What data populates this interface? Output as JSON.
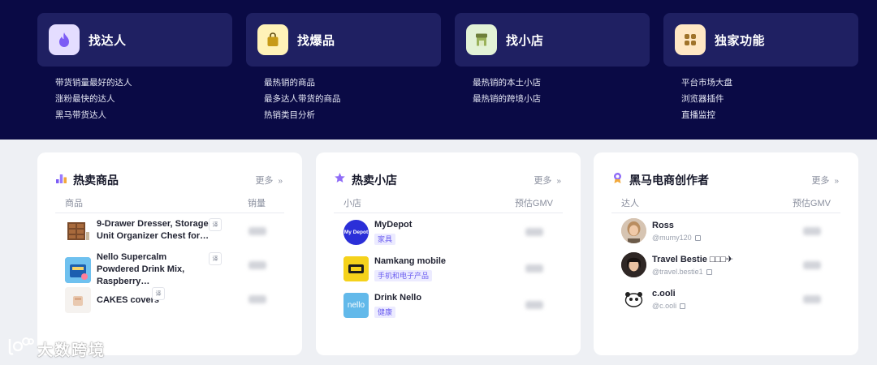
{
  "nav": [
    {
      "title": "找达人",
      "icon": "flame-icon",
      "icon_bg": "#e4ddff",
      "links": [
        "带货销量最好的达人",
        "涨粉最快的达人",
        "黑马带货达人"
      ]
    },
    {
      "title": "找爆品",
      "icon": "shopping-bag-icon",
      "icon_bg": "#fff2b8",
      "links": [
        "最热销的商品",
        "最多达人带货的商品",
        "热销类目分析"
      ]
    },
    {
      "title": "找小店",
      "icon": "storefront-icon",
      "icon_bg": "#e3f2d6",
      "links": [
        "最热销的本土小店",
        "最热销的跨境小店"
      ]
    },
    {
      "title": "独家功能",
      "icon": "grid-icon",
      "icon_bg": "#ffe7c4",
      "links": [
        "平台市场大盘",
        "浏览器插件",
        "直播监控"
      ]
    }
  ],
  "panels": {
    "products": {
      "title": "热卖商品",
      "more": "更多",
      "col_left": "商品",
      "col_right": "销量",
      "rows": [
        {
          "name": "9-Drawer Dresser, Storage Unit Organizer Chest for…"
        },
        {
          "name": "Nello Supercalm Powdered Drink Mix, Raspberry…"
        },
        {
          "name": "CAKES covers"
        }
      ]
    },
    "shops": {
      "title": "热卖小店",
      "more": "更多",
      "col_left": "小店",
      "col_right": "预估GMV",
      "rows": [
        {
          "name": "MyDepot",
          "tag": "家具",
          "logo_text": "My Depot"
        },
        {
          "name": "Namkang mobile",
          "tag": "手机和电子产品",
          "logo_text": ""
        },
        {
          "name": "Drink Nello",
          "tag": "健康",
          "logo_text": "nello"
        }
      ]
    },
    "creators": {
      "title": "黑马电商创作者",
      "more": "更多",
      "col_left": "达人",
      "col_right": "预估GMV",
      "rows": [
        {
          "name": "Ross",
          "handle": "@mumy120"
        },
        {
          "name": "Travel Bestie □□□✈",
          "handle": "@travel.bestie1"
        },
        {
          "name": "c.ooli",
          "handle": "@c.ooli"
        }
      ]
    }
  },
  "translate_label": "译",
  "watermark": "大数跨境",
  "colors": {
    "band": "#0a0a45",
    "nav_card": "#1f2062",
    "accent": "#6a5cf0"
  }
}
